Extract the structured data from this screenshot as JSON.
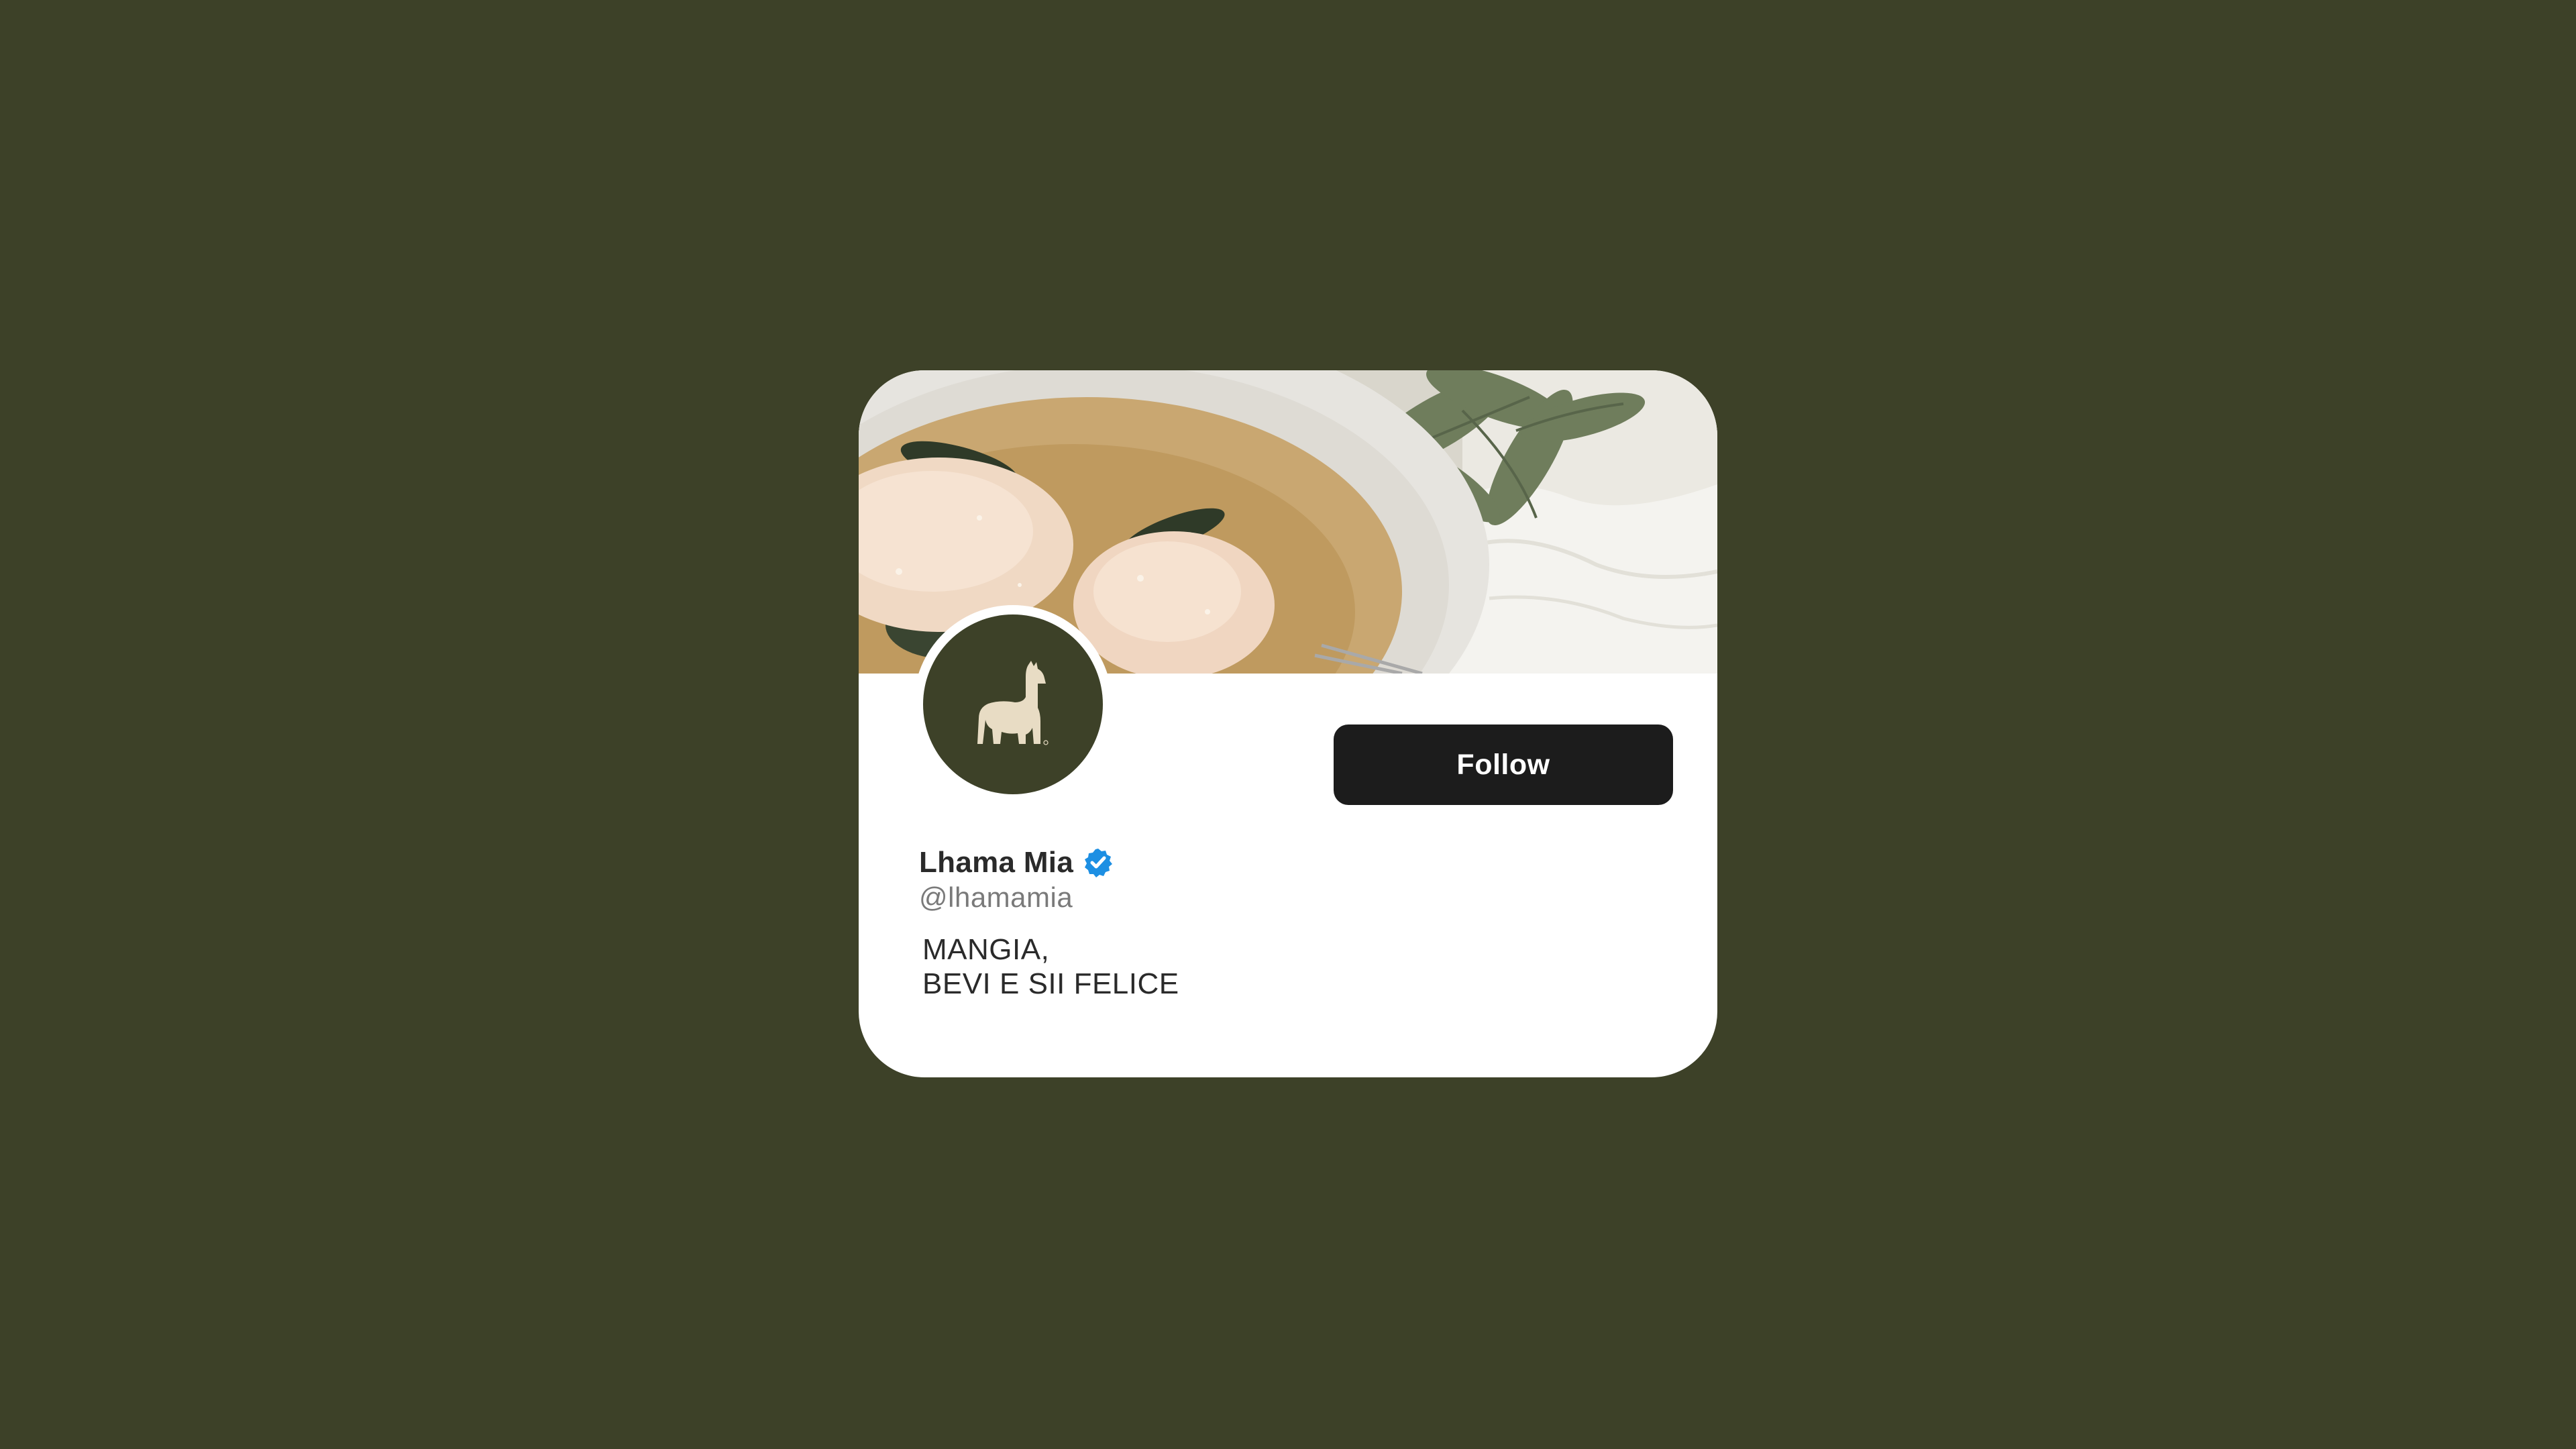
{
  "colors": {
    "page_background": "#3d4128",
    "card_background": "#ffffff",
    "avatar_background": "#3d4128",
    "llama_logo": "#e8dcc4",
    "follow_button": "#1c1c1c",
    "follow_text": "#ffffff",
    "verified_badge": "#1d8fe3",
    "name_text": "#2a2a2a",
    "handle_text": "#7a7a7a"
  },
  "profile": {
    "cover_image": "food-photo-ravioli-with-sage",
    "avatar_logo": "llama-logo-icon",
    "display_name": "Lhama Mia",
    "verified": true,
    "verified_icon": "verified-badge-icon",
    "handle": "@lhamamia",
    "bio_lines": [
      "MANGIA,",
      "BEVI E SII FELICE"
    ]
  },
  "actions": {
    "follow_label": "Follow"
  }
}
